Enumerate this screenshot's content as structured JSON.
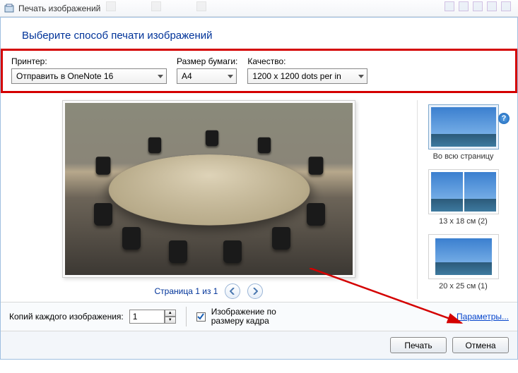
{
  "window": {
    "title": "Печать изображений"
  },
  "header": {
    "title": "Выберите способ печати изображений"
  },
  "settings": {
    "printer_label": "Принтер:",
    "printer_value": "Отправить в OneNote 16",
    "paper_label": "Размер бумаги:",
    "paper_value": "A4",
    "quality_label": "Качество:",
    "quality_value": "1200 x 1200 dots per in"
  },
  "help": {
    "tooltip": "?"
  },
  "pager": {
    "text": "Страница 1 из 1"
  },
  "layouts": {
    "full": "Во всю страницу",
    "l2": "13 x 18 см (2)",
    "l3": "20 x 25 см (1)"
  },
  "bottom": {
    "copies_label": "Копий каждого изображения:",
    "copies_value": "1",
    "fit_label": "Изображение по размеру кадра",
    "params_link": "Параметры..."
  },
  "buttons": {
    "print": "Печать",
    "cancel": "Отмена"
  }
}
